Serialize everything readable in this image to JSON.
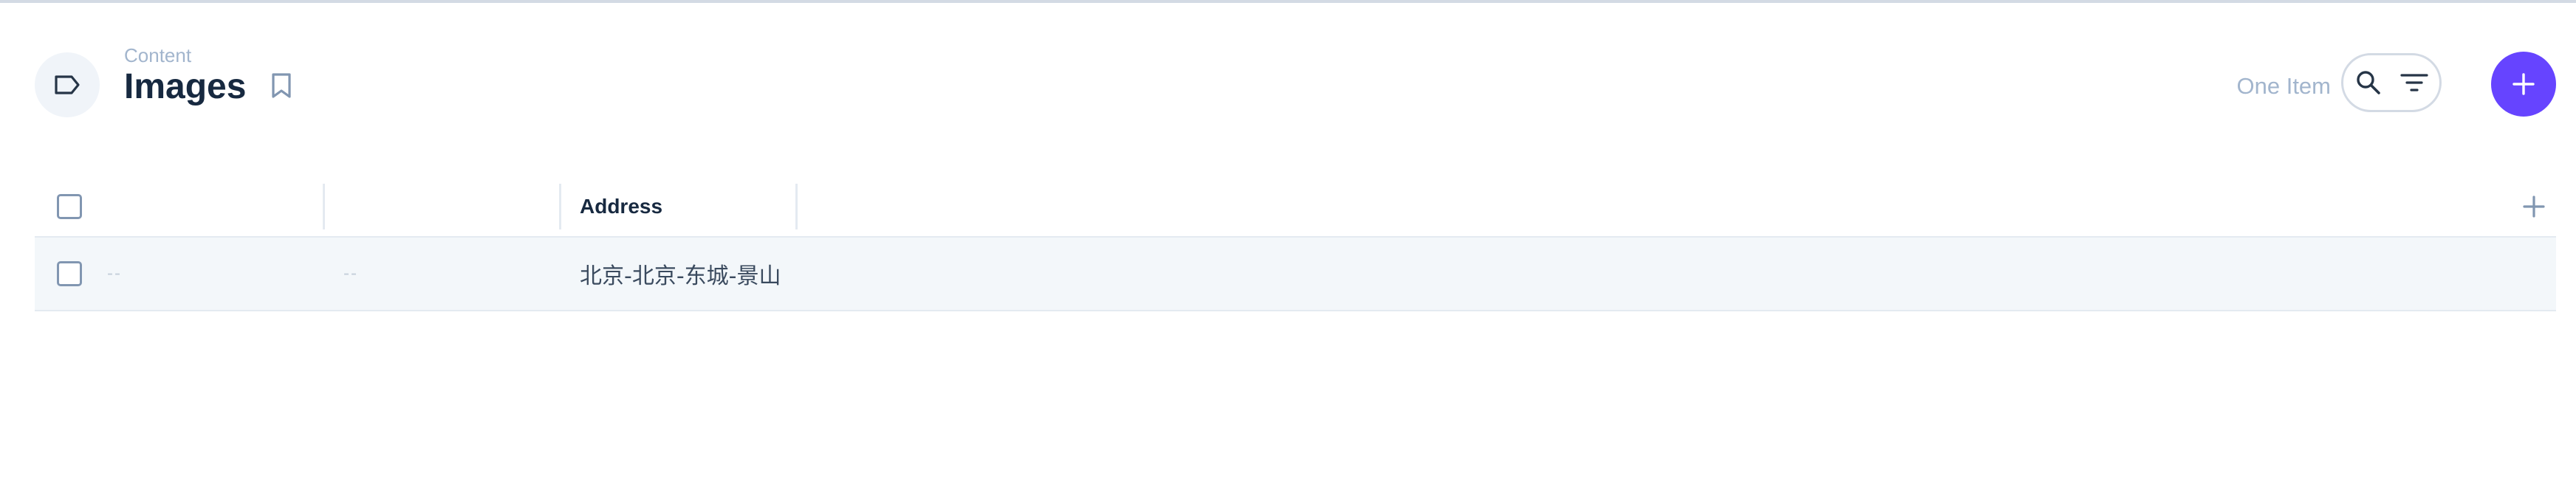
{
  "header": {
    "breadcrumb": "Content",
    "title": "Images",
    "item_count": "One Item",
    "title_icon": "label-icon",
    "bookmark_icon": "bookmark-icon",
    "search_icon": "search-icon",
    "filter_icon": "filter-icon",
    "add_icon": "plus-icon"
  },
  "table": {
    "columns": [
      "",
      "",
      "Address"
    ],
    "rows": [
      {
        "cells": [
          "--",
          "--",
          "北京-北京-东城-景山"
        ]
      }
    ],
    "add_column_icon": "plus-icon"
  },
  "colors": {
    "accent": "#6644ff",
    "title": "#172940",
    "muted": "#a2b5cd",
    "row_background": "#f3f7fa"
  }
}
